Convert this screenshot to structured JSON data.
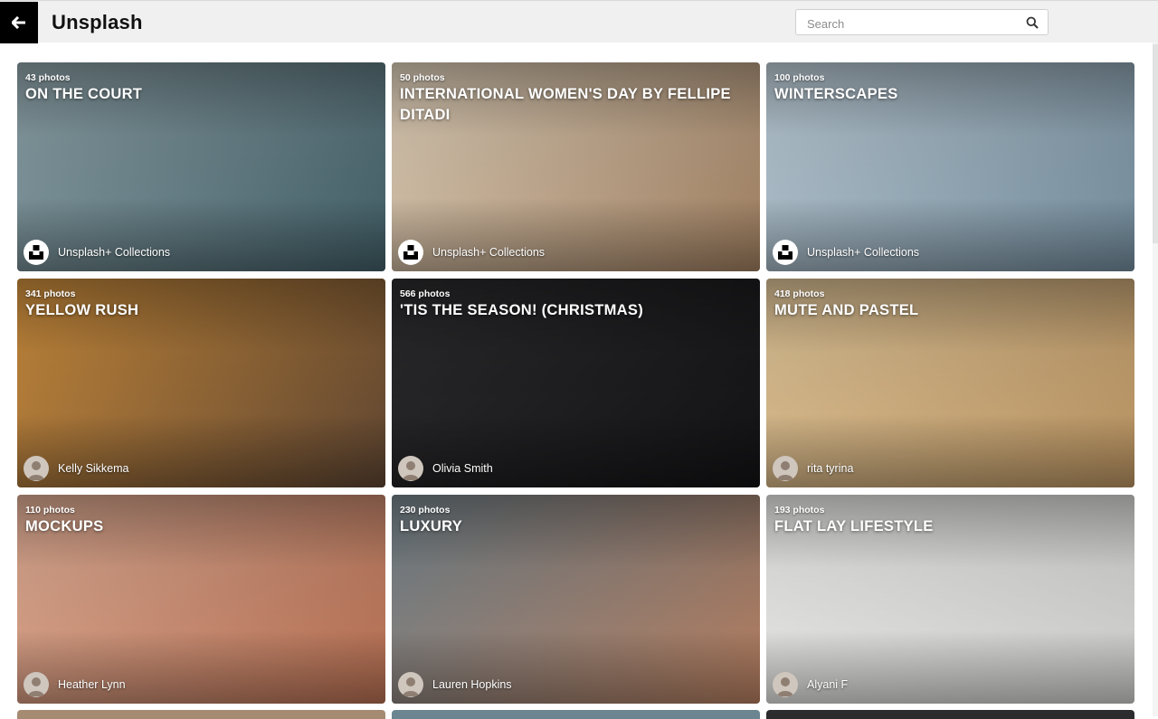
{
  "header": {
    "back_icon": "arrow-left-icon",
    "title": "Unsplash",
    "search_placeholder": "Search",
    "search_icon": "search-icon"
  },
  "collections": [
    {
      "count": "43 photos",
      "title": "ON THE COURT",
      "author": "Unsplash+ Collections",
      "avatar": "unsplash-plus-logo",
      "colors": [
        "#8a9ea4",
        "#3f5b63"
      ]
    },
    {
      "count": "50 photos",
      "title": "INTERNATIONAL WOMEN'S DAY BY FELLIPE DITADI",
      "author": "Unsplash+ Collections",
      "avatar": "unsplash-plus-logo",
      "colors": [
        "#d9cbb6",
        "#9a7a5c"
      ]
    },
    {
      "count": "100 photos",
      "title": "WINTERSCAPES",
      "author": "Unsplash+ Collections",
      "avatar": "unsplash-plus-logo",
      "colors": [
        "#b7c6d0",
        "#6f8797"
      ]
    },
    {
      "count": "341 photos",
      "title": "YELLOW RUSH",
      "author": "Kelly Sikkema",
      "avatar": "user-avatar",
      "colors": [
        "#c98b3b",
        "#5a4230"
      ]
    },
    {
      "count": "566 photos",
      "title": "'TIS THE SEASON! (CHRISTMAS)",
      "author": "Olivia Smith",
      "avatar": "user-avatar",
      "colors": [
        "#2a2a2c",
        "#121214"
      ]
    },
    {
      "count": "418 photos",
      "title": "MUTE AND PASTEL",
      "author": "rita tyrina",
      "avatar": "user-avatar",
      "colors": [
        "#d9bf94",
        "#b48f5e"
      ]
    },
    {
      "count": "110 photos",
      "title": "MOCKUPS",
      "author": "Heather Lynn",
      "avatar": "user-avatar",
      "colors": [
        "#d8a891",
        "#b06b4f"
      ]
    },
    {
      "count": "230 photos",
      "title": "LUXURY",
      "author": "Lauren Hopkins",
      "avatar": "user-avatar",
      "colors": [
        "#6f7f88",
        "#b07a5c"
      ]
    },
    {
      "count": "193 photos",
      "title": "FLAT LAY LIFESTYLE",
      "author": "Alyani F",
      "avatar": "user-avatar",
      "colors": [
        "#e4e4e2",
        "#c8c8c6"
      ]
    }
  ],
  "peek_colors": [
    "#a58b72",
    "#6b8591",
    "#2c2c2e"
  ]
}
